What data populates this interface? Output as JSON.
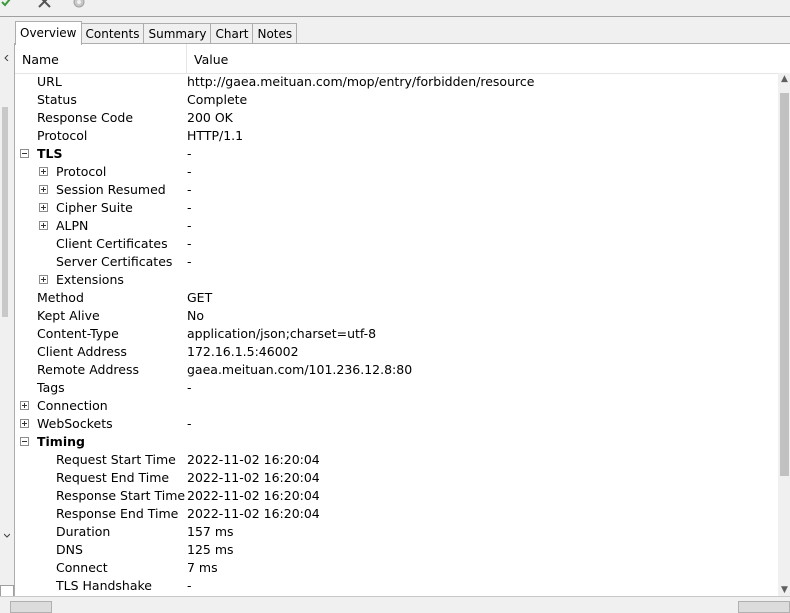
{
  "tabs": [
    "Overview",
    "Contents",
    "Summary",
    "Chart",
    "Notes"
  ],
  "columns": {
    "name": "Name",
    "value": "Value"
  },
  "rows": [
    {
      "name": "URL",
      "value": "http://gaea.meituan.com/mop/entry/forbidden/resource",
      "level": 1,
      "expander": "",
      "bold": false
    },
    {
      "name": "Status",
      "value": "Complete",
      "level": 1,
      "expander": "",
      "bold": false
    },
    {
      "name": "Response Code",
      "value": "200 OK",
      "level": 1,
      "expander": "",
      "bold": false
    },
    {
      "name": "Protocol",
      "value": "HTTP/1.1",
      "level": 1,
      "expander": "",
      "bold": false
    },
    {
      "name": "TLS",
      "value": "-",
      "level": 1,
      "expander": "minus",
      "bold": true
    },
    {
      "name": "Protocol",
      "value": "-",
      "level": 2,
      "expander": "plus",
      "bold": false
    },
    {
      "name": "Session Resumed",
      "value": "-",
      "level": 2,
      "expander": "plus",
      "bold": false
    },
    {
      "name": "Cipher Suite",
      "value": "-",
      "level": 2,
      "expander": "plus",
      "bold": false
    },
    {
      "name": "ALPN",
      "value": "-",
      "level": 2,
      "expander": "plus",
      "bold": false
    },
    {
      "name": "Client Certificates",
      "value": "-",
      "level": 2,
      "expander": "",
      "bold": false
    },
    {
      "name": "Server Certificates",
      "value": "-",
      "level": 2,
      "expander": "",
      "bold": false
    },
    {
      "name": "Extensions",
      "value": "",
      "level": 2,
      "expander": "plus",
      "bold": false
    },
    {
      "name": "Method",
      "value": "GET",
      "level": 1,
      "expander": "",
      "bold": false
    },
    {
      "name": "Kept Alive",
      "value": "No",
      "level": 1,
      "expander": "",
      "bold": false
    },
    {
      "name": "Content-Type",
      "value": "application/json;charset=utf-8",
      "level": 1,
      "expander": "",
      "bold": false
    },
    {
      "name": "Client Address",
      "value": "172.16.1.5:46002",
      "level": 1,
      "expander": "",
      "bold": false
    },
    {
      "name": "Remote Address",
      "value": "gaea.meituan.com/101.236.12.8:80",
      "level": 1,
      "expander": "",
      "bold": false
    },
    {
      "name": "Tags",
      "value": "-",
      "level": 1,
      "expander": "",
      "bold": false
    },
    {
      "name": "Connection",
      "value": "",
      "level": 1,
      "expander": "plus",
      "bold": false
    },
    {
      "name": "WebSockets",
      "value": "-",
      "level": 1,
      "expander": "plus",
      "bold": false
    },
    {
      "name": "Timing",
      "value": "",
      "level": 1,
      "expander": "minus",
      "bold": true
    },
    {
      "name": "Request Start Time",
      "value": "2022-11-02 16:20:04",
      "level": 2,
      "expander": "",
      "bold": false
    },
    {
      "name": "Request End Time",
      "value": "2022-11-02 16:20:04",
      "level": 2,
      "expander": "",
      "bold": false
    },
    {
      "name": "Response Start Time",
      "value": "2022-11-02 16:20:04",
      "level": 2,
      "expander": "",
      "bold": false
    },
    {
      "name": "Response End Time",
      "value": "2022-11-02 16:20:04",
      "level": 2,
      "expander": "",
      "bold": false
    },
    {
      "name": "Duration",
      "value": "157 ms",
      "level": 2,
      "expander": "",
      "bold": false
    },
    {
      "name": "DNS",
      "value": "125 ms",
      "level": 2,
      "expander": "",
      "bold": false
    },
    {
      "name": "Connect",
      "value": "7 ms",
      "level": 2,
      "expander": "",
      "bold": false
    },
    {
      "name": "TLS Handshake",
      "value": "-",
      "level": 2,
      "expander": "",
      "bold": false
    }
  ],
  "icons": {
    "toolbar": [
      "check-icon",
      "tools-icon",
      "gear-icon"
    ],
    "scroll_up": "▲",
    "scroll_down": "▼"
  }
}
